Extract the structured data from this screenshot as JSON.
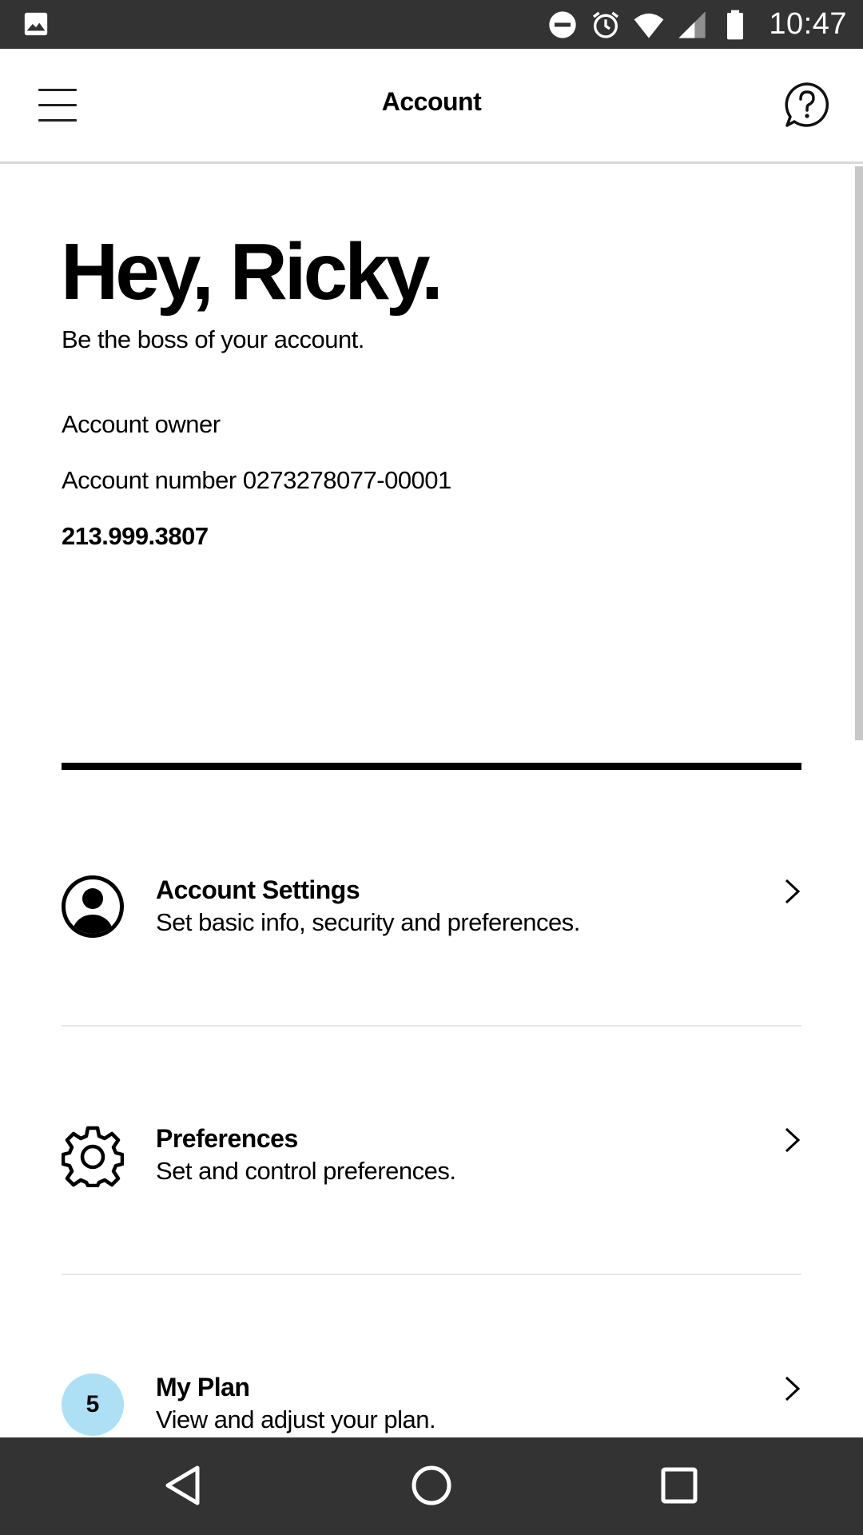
{
  "status_bar": {
    "time": "10:47",
    "icons": [
      "image-icon",
      "do-not-disturb-icon",
      "alarm-icon",
      "wifi-icon",
      "signal-icon",
      "battery-icon"
    ]
  },
  "header": {
    "title": "Account",
    "menu_icon": "hamburger-menu-icon",
    "help_icon": "help-chat-icon"
  },
  "profile": {
    "greeting": "Hey, Ricky.",
    "tagline": "Be the boss of your account.",
    "role": "Account owner",
    "account_number": "Account number 0273278077-00001",
    "phone": "213.999.3807"
  },
  "menu": {
    "items": [
      {
        "title": "Account Settings",
        "subtitle": "Set basic info, security and preferences.",
        "icon": "user-circle-icon"
      },
      {
        "title": "Preferences",
        "subtitle": "Set and control preferences.",
        "icon": "gear-icon"
      },
      {
        "title": "My Plan",
        "subtitle": "View and adjust your plan.",
        "badge": "5",
        "icon": "plan-badge"
      }
    ]
  },
  "colors": {
    "status_bar": "#333333",
    "nav_bar": "#333333",
    "plan_badge": "#aee0f5",
    "divider": "#e6e6e6"
  },
  "nav_bar": {
    "icons": [
      "back-triangle-icon",
      "home-circle-icon",
      "recents-square-icon"
    ]
  }
}
